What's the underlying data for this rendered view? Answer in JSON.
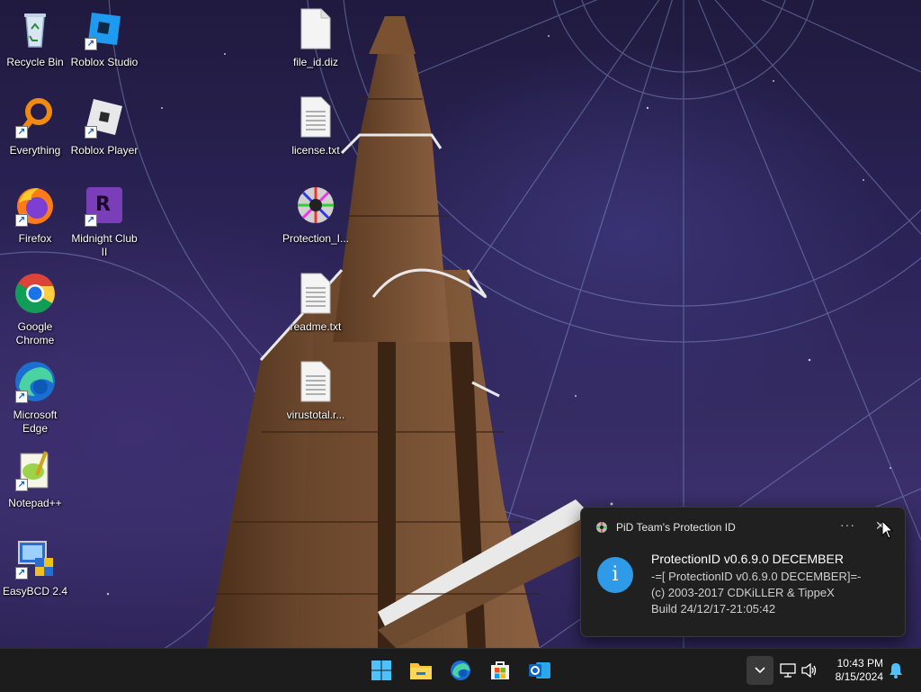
{
  "desktop": {
    "icons": [
      {
        "label": "Recycle Bin",
        "icon": "recycle-bin-icon"
      },
      {
        "label": "Roblox Studio",
        "icon": "roblox-studio-icon"
      },
      {
        "label": "file_id.diz",
        "icon": "file-icon"
      },
      {
        "label": "Everything",
        "icon": "everything-search-icon"
      },
      {
        "label": "Roblox Player",
        "icon": "roblox-player-icon"
      },
      {
        "label": "license.txt",
        "icon": "text-file-icon"
      },
      {
        "label": "Firefox",
        "icon": "firefox-icon"
      },
      {
        "label": "Midnight Club II",
        "icon": "midnight-club-icon"
      },
      {
        "label": "Protection_I...",
        "icon": "protection-id-icon"
      },
      {
        "label": "Google Chrome",
        "icon": "chrome-icon"
      },
      {
        "label": "readme.txt",
        "icon": "text-file-icon"
      },
      {
        "label": "Microsoft Edge",
        "icon": "edge-icon"
      },
      {
        "label": "virustotal.r...",
        "icon": "text-file-icon"
      },
      {
        "label": "Notepad++",
        "icon": "notepad-plus-plus-icon"
      },
      {
        "label": "EasyBCD 2.4",
        "icon": "easybcd-icon"
      }
    ]
  },
  "notification": {
    "app_name": "PiD Team's Protection ID",
    "more_label": "···",
    "close_label": "✕",
    "info_glyph": "i",
    "title": "ProtectionID v0.6.9.0 DECEMBER",
    "lines": [
      "-=[ ProtectionID v0.6.9.0 DECEMBER]=-",
      "(c) 2003-2017 CDKiLLER & TippeX",
      "Build 24/12/17-21:05:42"
    ]
  },
  "taskbar": {
    "apps": [
      "start-icon",
      "file-explorer-icon",
      "edge-icon",
      "microsoft-store-icon",
      "outlook-icon"
    ],
    "tray_chevron": "⌄",
    "time": "10:43 PM",
    "date": "8/15/2024"
  },
  "colors": {
    "taskbar_bg": "#1c1c1c",
    "toast_bg": "#202020",
    "info_blue": "#2f9be8"
  }
}
